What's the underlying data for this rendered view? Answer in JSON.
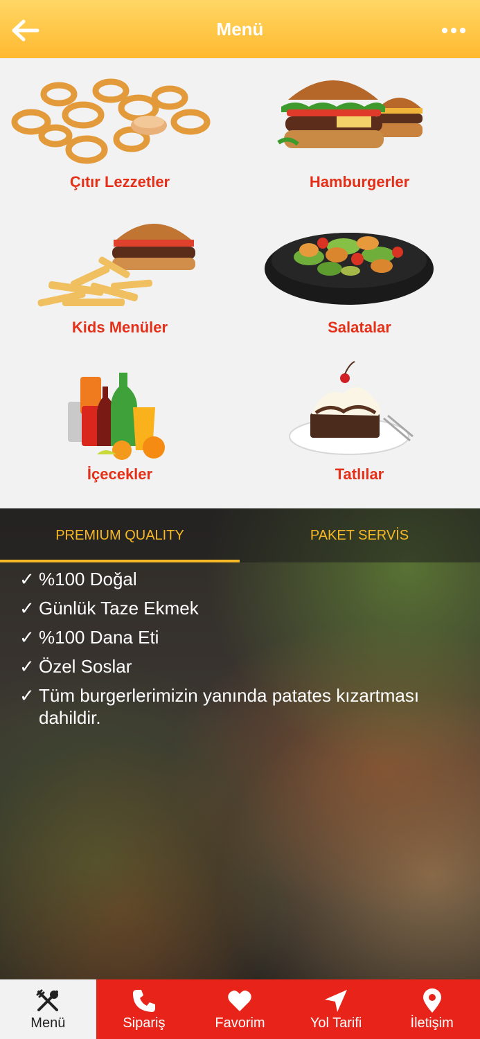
{
  "header": {
    "title": "Menü"
  },
  "categories": [
    {
      "label": "Çıtır Lezzetler"
    },
    {
      "label": "Hamburgerler"
    },
    {
      "label": "Kids Menüler"
    },
    {
      "label": "Salatalar"
    },
    {
      "label": "İçecekler"
    },
    {
      "label": "Tatlılar"
    }
  ],
  "panel": {
    "tabs": [
      "PREMIUM QUALITY",
      "PAKET SERVİS"
    ],
    "check": "✓",
    "features": [
      "%100 Doğal",
      "Günlük Taze Ekmek",
      "%100 Dana Eti",
      "Özel Soslar",
      "Tüm burgerlerimizin yanında patates kızartması dahildir."
    ]
  },
  "nav": {
    "items": [
      {
        "label": "Menü",
        "icon": "fork-knife-icon"
      },
      {
        "label": "Sipariş",
        "icon": "phone-icon"
      },
      {
        "label": "Favorim",
        "icon": "heart-icon"
      },
      {
        "label": "Yol Tarifi",
        "icon": "navigation-arrow-icon"
      },
      {
        "label": "İletişim",
        "icon": "location-pin-icon"
      }
    ]
  },
  "colors": {
    "accent": "#e53019",
    "header": "#ffc23f",
    "tab": "#f6b824",
    "nav": "#e8241a"
  }
}
